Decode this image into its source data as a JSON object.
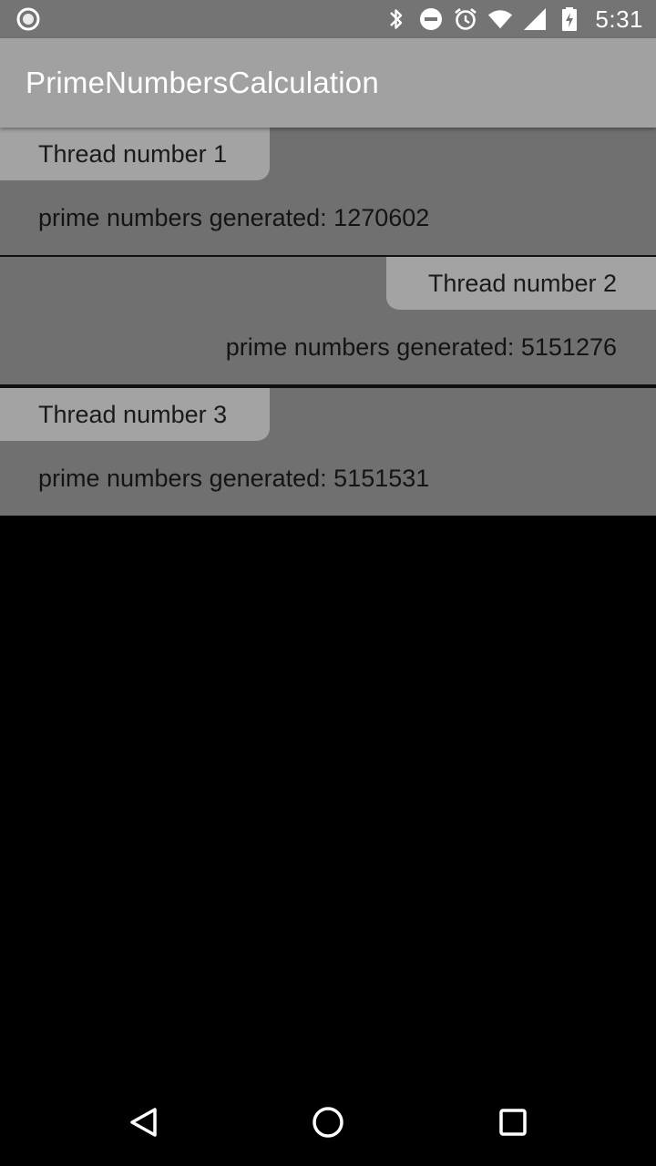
{
  "status_bar": {
    "time": "5:31",
    "icons": [
      "record-icon",
      "bluetooth-icon",
      "do-not-disturb-icon",
      "alarm-icon",
      "wifi-icon",
      "signal-icon",
      "battery-charging-icon"
    ]
  },
  "app_bar": {
    "title": "PrimeNumbersCalculation"
  },
  "threads": [
    {
      "label": "Thread number 1",
      "result": "prime numbers generated: 1270602"
    },
    {
      "label": "Thread number 2",
      "result": "prime numbers generated: 5151276"
    },
    {
      "label": "Thread number 3",
      "result": "prime numbers generated: 5151531"
    }
  ],
  "nav_bar": {
    "buttons": [
      "back-icon",
      "home-icon",
      "recents-icon"
    ]
  },
  "colors": {
    "status_bar": "#747474",
    "app_bar": "#a1a1a1",
    "card": "#707070",
    "tab": "#a3a3a3",
    "background": "#000000"
  }
}
